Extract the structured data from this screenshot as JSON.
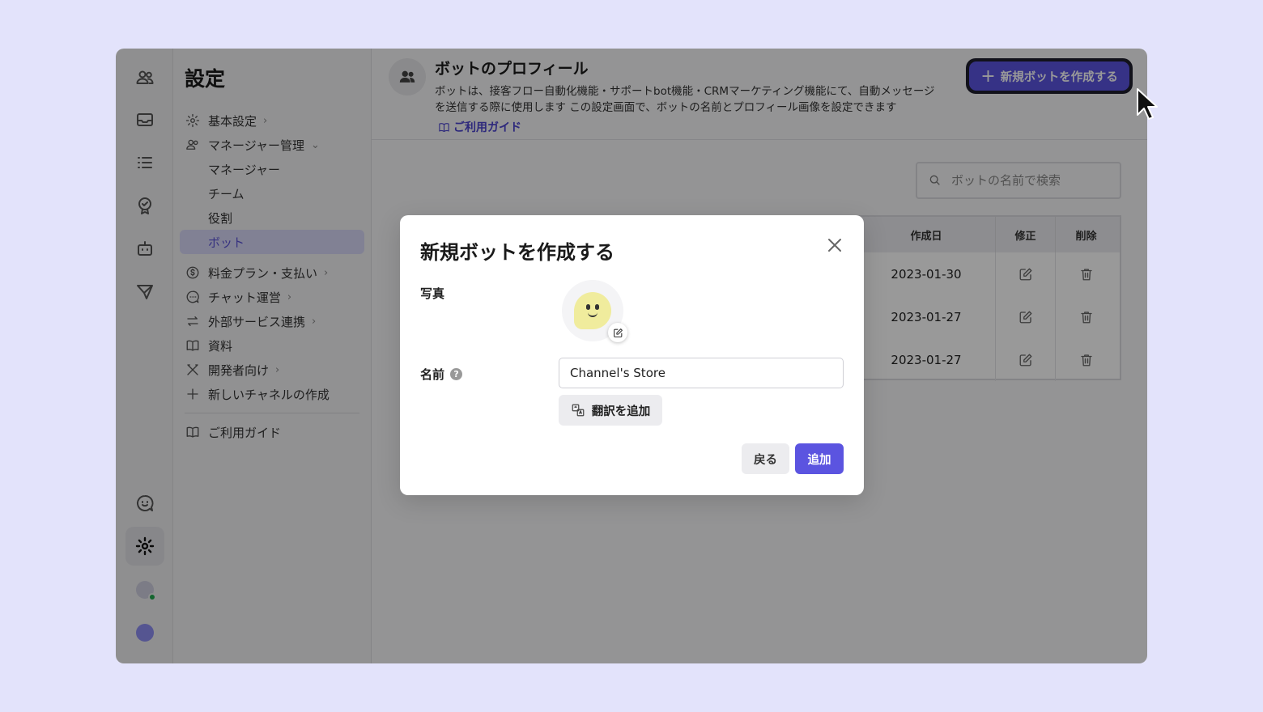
{
  "nav": {
    "title": "設定",
    "items": [
      {
        "label": "基本設定",
        "icon": "gear-icon",
        "has_chevron": true
      },
      {
        "label": "マネージャー管理",
        "icon": "people-icon",
        "has_chevron": true
      }
    ],
    "sub_items": [
      "マネージャー",
      "チーム",
      "役割",
      "ボット"
    ],
    "items2": [
      {
        "label": "料金プラン・支払い",
        "icon": "dollar-icon"
      },
      {
        "label": "チャット運営",
        "icon": "chat-icon"
      },
      {
        "label": "外部サービス連携",
        "icon": "swap-icon"
      },
      {
        "label": "資料",
        "icon": "book-icon"
      },
      {
        "label": "開発者向け",
        "icon": "tools-icon"
      },
      {
        "label": "新しいチャネルの作成",
        "icon": "plus-icon"
      }
    ],
    "guide": "ご利用ガイド"
  },
  "header": {
    "title": "ボットのプロフィール",
    "desc_line1": "ボットは、接客フロー自動化機能・サポートbot機能・CRMマーケティング機能にて、自動メッセージ",
    "desc_line2": "を送信する際に使用します この設定画面で、ボットの名前とプロフィール画像を設定できます",
    "guide_link": "ご利用ガイド",
    "create_button": "新規ボットを作成する"
  },
  "search": {
    "placeholder": "ボットの名前で検索"
  },
  "table": {
    "headers": {
      "date": "作成日",
      "edit": "修正",
      "delete": "削除"
    },
    "rows": [
      {
        "date": "2023-01-30"
      },
      {
        "date": "2023-01-27"
      },
      {
        "date": "2023-01-27"
      }
    ]
  },
  "modal": {
    "title": "新規ボットを作成する",
    "photo_label": "写真",
    "name_label": "名前",
    "name_value": "Channel's Store",
    "translate_button": "翻訳を追加",
    "back_button": "戻る",
    "add_button": "追加"
  },
  "colors": {
    "accent": "#5b54e0",
    "accent_text": "#4b44cf",
    "active_nav_bg": "#d7d7f7"
  }
}
